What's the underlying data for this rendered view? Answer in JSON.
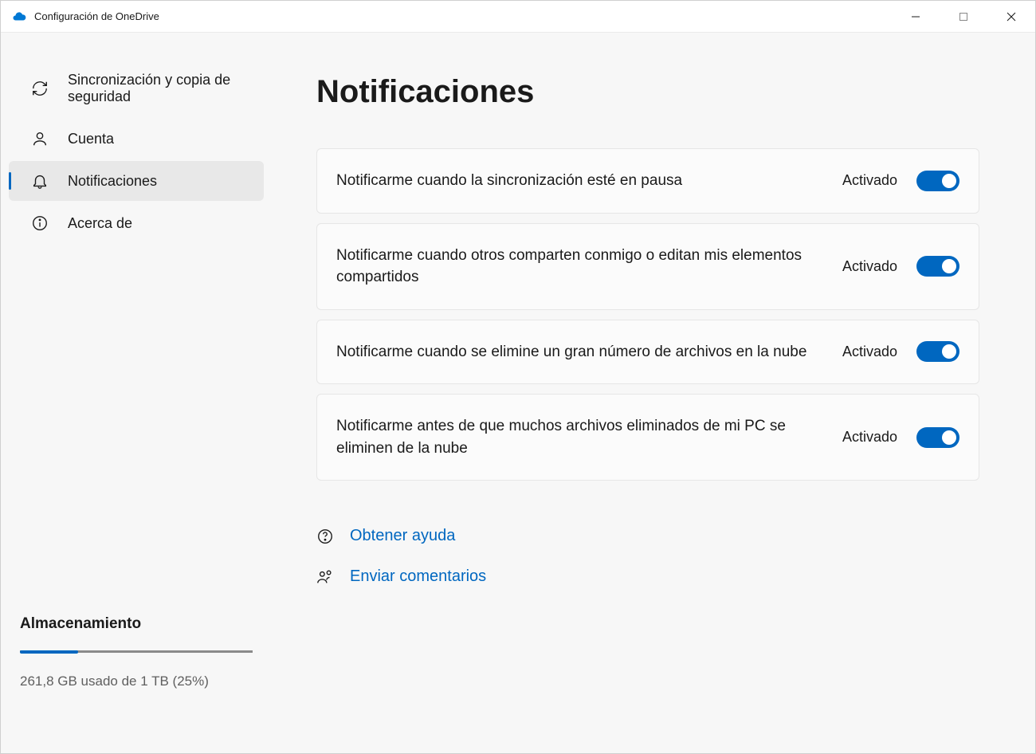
{
  "window": {
    "title": "Configuración de OneDrive"
  },
  "nav": {
    "items": [
      {
        "label": "Sincronización y copia de seguridad",
        "icon": "sync"
      },
      {
        "label": "Cuenta",
        "icon": "account"
      },
      {
        "label": "Notificaciones",
        "icon": "bell",
        "active": true
      },
      {
        "label": "Acerca de",
        "icon": "info"
      }
    ]
  },
  "storage": {
    "title": "Almacenamiento",
    "text": "261,8 GB usado de 1 TB (25%)",
    "percent": 25
  },
  "page": {
    "title": "Notificaciones"
  },
  "settings": [
    {
      "label": "Notificarme cuando la sincronización esté en pausa",
      "state": "Activado"
    },
    {
      "label": "Notificarme cuando otros comparten conmigo o editan mis elementos compartidos",
      "state": "Activado"
    },
    {
      "label": "Notificarme cuando se elimine un gran número de archivos en la nube",
      "state": "Activado"
    },
    {
      "label": "Notificarme antes de que muchos archivos eliminados de mi PC se eliminen de la nube",
      "state": "Activado"
    }
  ],
  "help": {
    "get_help": "Obtener ayuda",
    "feedback": "Enviar comentarios"
  }
}
